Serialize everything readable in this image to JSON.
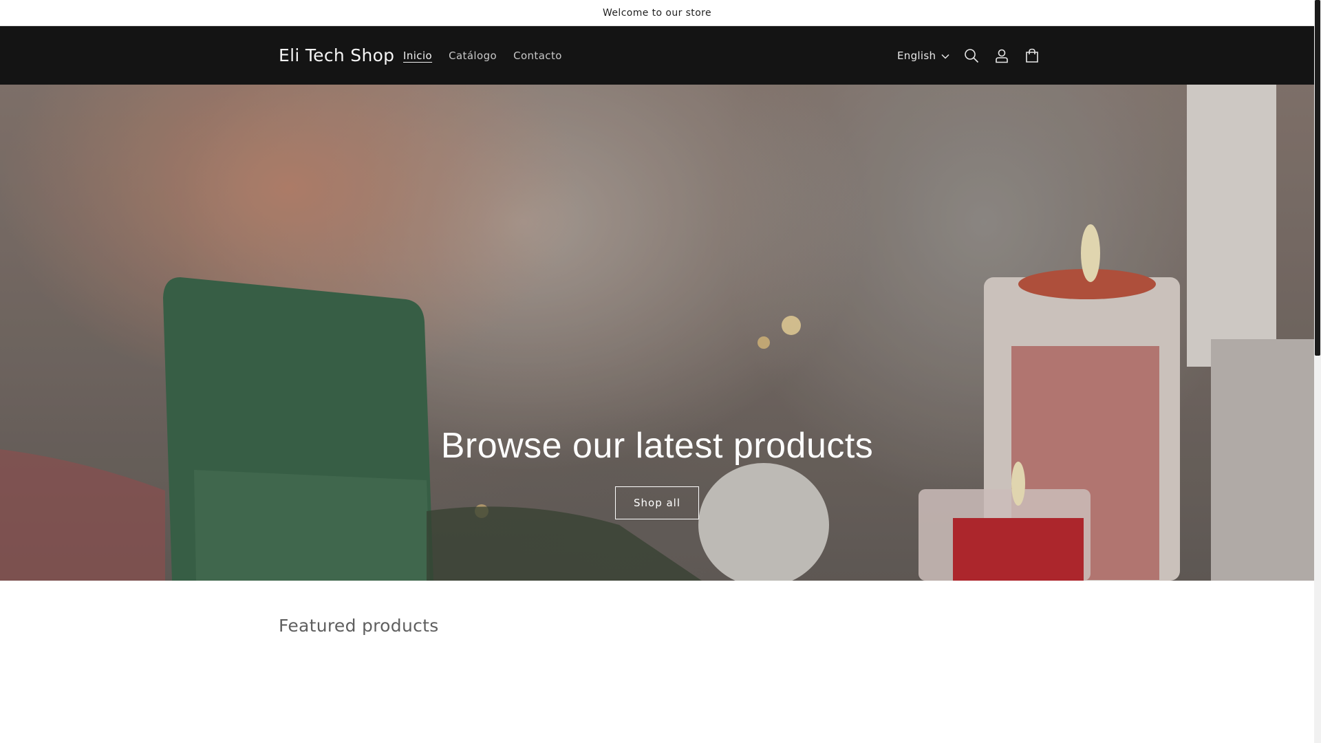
{
  "announcement": {
    "text": "Welcome to our store"
  },
  "header": {
    "brand": "Eli Tech Shop",
    "nav": [
      {
        "label": "Inicio",
        "active": true
      },
      {
        "label": "Catálogo",
        "active": false
      },
      {
        "label": "Contacto",
        "active": false
      }
    ],
    "language": "English",
    "icons": [
      "chevron-down-icon",
      "search-icon",
      "account-icon",
      "cart-icon"
    ]
  },
  "hero": {
    "title": "Browse our latest products",
    "button_label": "Shop all"
  },
  "featured": {
    "title": "Featured products"
  },
  "colors": {
    "header_bg": "#141414",
    "page_bg": "#ffffff",
    "scroll_thumb": "#1a1a1a"
  }
}
